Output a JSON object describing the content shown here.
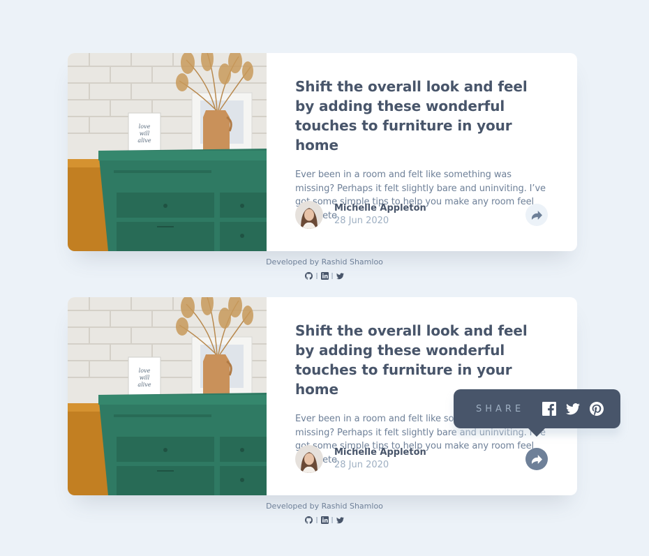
{
  "cards": [
    {
      "title": "Shift the overall look and feel by adding these wonderful touches to furniture in your home",
      "excerpt": "Ever been in a room and felt like something was missing? Perhaps it felt slightly bare and uninviting. I’ve got some simple tips to help you make any room feel complete.",
      "author": "Michelle Appleton",
      "date": "28 Jun 2020"
    },
    {
      "title": "Shift the overall look and feel by adding these wonderful touches to furniture in your home",
      "excerpt": "Ever been in a room and felt like something was missing? Perhaps it felt slightly bare and uninviting. I’ve got some simple tips to help you make any room feel complete.",
      "author": "Michelle Appleton",
      "date": "28 Jun 2020"
    }
  ],
  "credit": "Developed by Rashid Shamloo",
  "credit_separator": "|",
  "share": {
    "label": "SHARE"
  },
  "icons": [
    "share-icon",
    "github-icon",
    "linkedin-icon",
    "twitter-icon",
    "facebook-icon",
    "pinterest-icon"
  ],
  "colors": {
    "background": "#ecf2f8",
    "title": "#48556a",
    "text": "#6e8098",
    "muted": "#9eafc2",
    "popover": "#48556a"
  }
}
